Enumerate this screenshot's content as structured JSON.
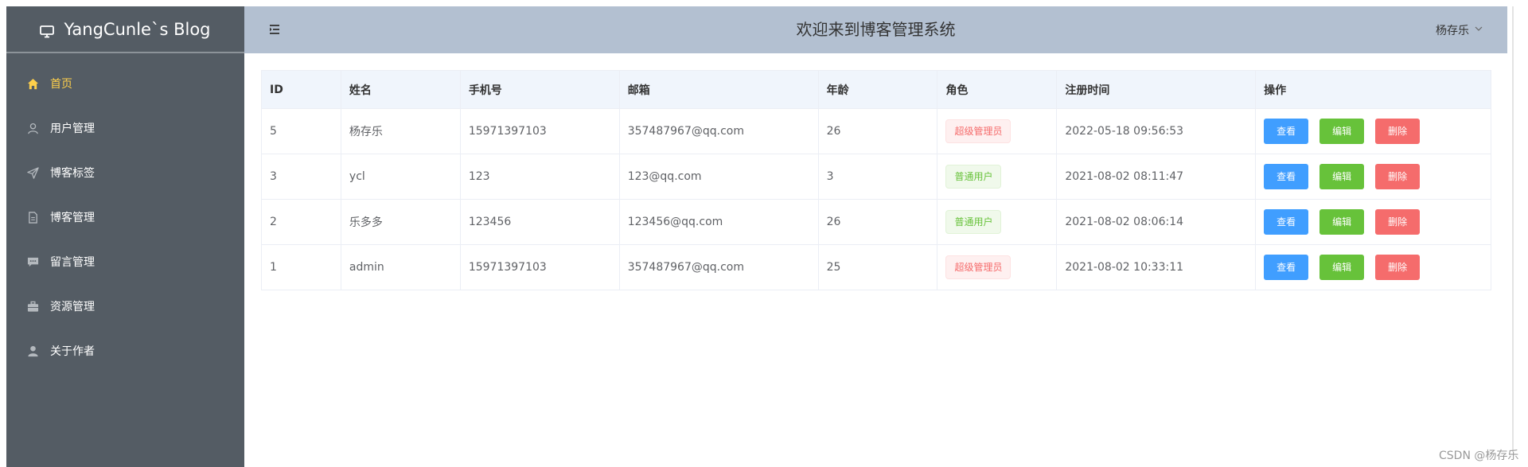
{
  "brand": {
    "title": "YangCunle`s Blog"
  },
  "sidebar": {
    "items": [
      {
        "label": "首页",
        "icon": "home-icon",
        "active": true
      },
      {
        "label": "用户管理",
        "icon": "user-icon"
      },
      {
        "label": "博客标签",
        "icon": "send-icon"
      },
      {
        "label": "博客管理",
        "icon": "document-icon"
      },
      {
        "label": "留言管理",
        "icon": "message-icon"
      },
      {
        "label": "资源管理",
        "icon": "briefcase-icon"
      },
      {
        "label": "关于作者",
        "icon": "person-icon"
      }
    ]
  },
  "header": {
    "title": "欢迎来到博客管理系统",
    "user": "杨存乐"
  },
  "table": {
    "columns": [
      "ID",
      "姓名",
      "手机号",
      "邮箱",
      "年龄",
      "角色",
      "注册时间",
      "操作"
    ],
    "actions": {
      "view": "查看",
      "edit": "编辑",
      "delete": "删除"
    },
    "rows": [
      {
        "id": "5",
        "name": "杨存乐",
        "phone": "15971397103",
        "email": "357487967@qq.com",
        "age": "26",
        "role": "超级管理员",
        "role_type": "red",
        "registered": "2022-05-18 09:56:53"
      },
      {
        "id": "3",
        "name": "ycl",
        "phone": "123",
        "email": "123@qq.com",
        "age": "3",
        "role": "普通用户",
        "role_type": "green",
        "registered": "2021-08-02 08:11:47"
      },
      {
        "id": "2",
        "name": "乐多多",
        "phone": "123456",
        "email": "123456@qq.com",
        "age": "26",
        "role": "普通用户",
        "role_type": "green",
        "registered": "2021-08-02 08:06:14"
      },
      {
        "id": "1",
        "name": "admin",
        "phone": "15971397103",
        "email": "357487967@qq.com",
        "age": "25",
        "role": "超级管理员",
        "role_type": "red",
        "registered": "2021-08-02 10:33:11"
      }
    ]
  },
  "watermark": "CSDN @杨存乐",
  "colors": {
    "sidebar": "#545c64",
    "header": "#b3c0d1",
    "active": "#ffd04b"
  }
}
